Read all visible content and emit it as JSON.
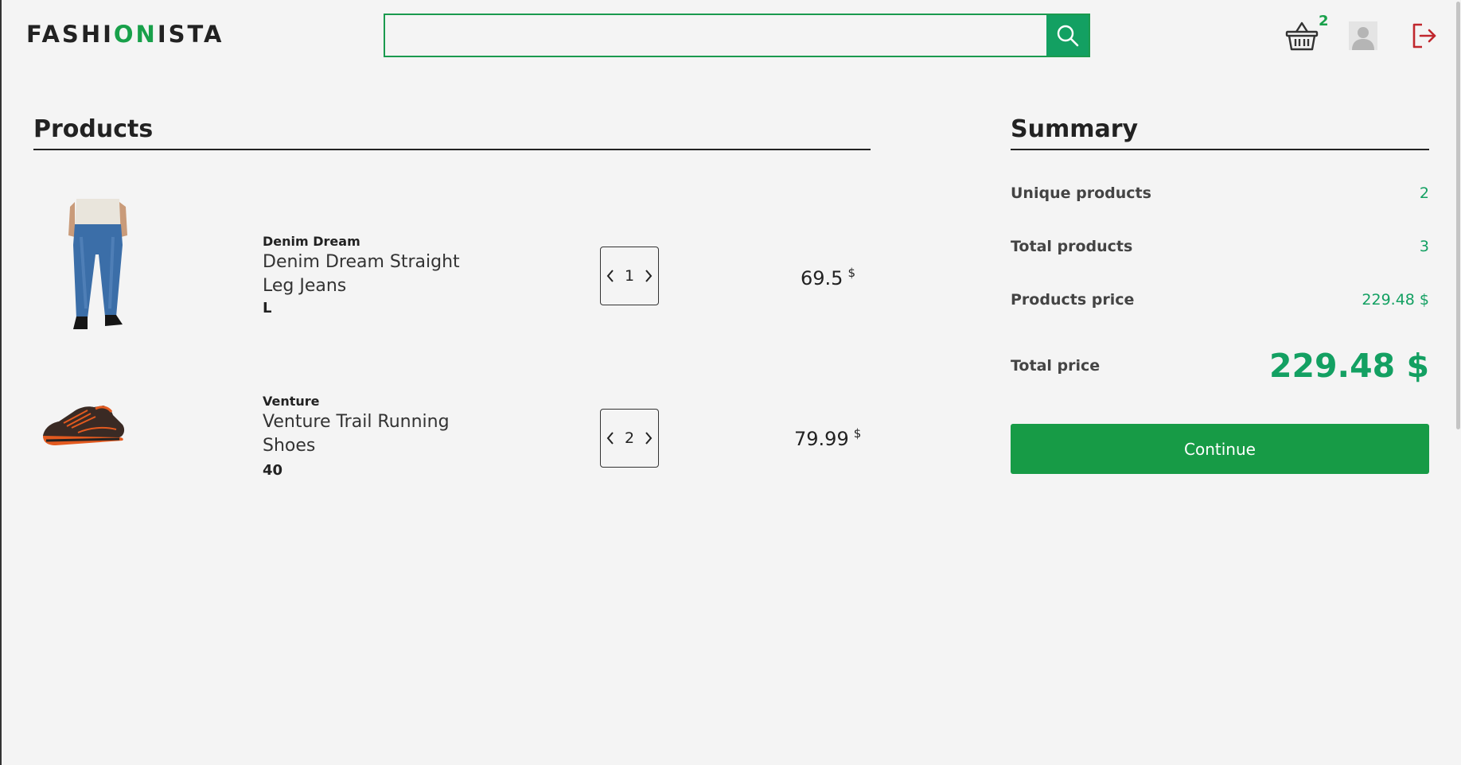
{
  "header": {
    "logo_part1": "FASHI",
    "logo_part2": "ON",
    "logo_part3": "ISTA",
    "search_value": "",
    "cart_count": "2"
  },
  "products_section": {
    "title": "Products",
    "items": [
      {
        "brand": "Denim Dream",
        "name": "Denim Dream Straight Leg Jeans",
        "size": "L",
        "quantity": "1",
        "price": "69.5",
        "currency": "$",
        "image": "jeans-image"
      },
      {
        "brand": "Venture",
        "name": "Venture Trail Running Shoes",
        "size": "40",
        "quantity": "2",
        "price": "79.99",
        "currency": "$",
        "image": "shoe-image"
      }
    ]
  },
  "summary": {
    "title": "Summary",
    "unique_label": "Unique products",
    "unique_value": "2",
    "total_products_label": "Total products",
    "total_products_value": "3",
    "products_price_label": "Products price",
    "products_price_value": "229.48 $",
    "total_price_label": "Total price",
    "total_price_value": "229.48 $",
    "continue_label": "Continue"
  },
  "colors": {
    "accent": "#13a062",
    "button": "#179b46",
    "logout": "#c0272d"
  }
}
